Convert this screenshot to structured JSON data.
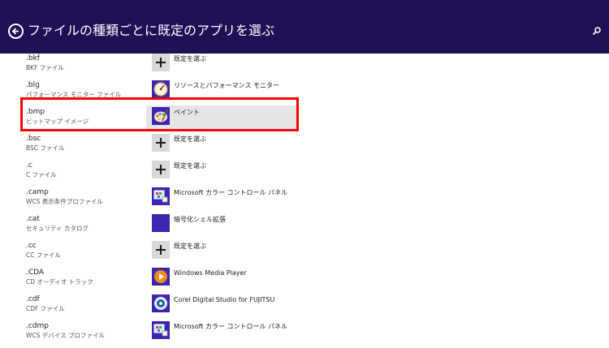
{
  "header": {
    "title": "ファイルの種類ごとに既定のアプリを選ぶ",
    "background_color": "#1f0f55",
    "back_icon": "back-arrow-circle-icon",
    "search_icon": "search-icon"
  },
  "highlight_color": "#ff0000",
  "associations": [
    {
      "ext": ".bkf",
      "desc": "BKF ファイル",
      "app": "既定を選ぶ",
      "icon": "plus-icon"
    },
    {
      "ext": ".blg",
      "desc": "パフォーマンス モニター ファイル",
      "app": "リソースとパフォーマンス モニター",
      "icon": "performance-monitor-icon"
    },
    {
      "ext": ".bmp",
      "desc": "ビットマップ イメージ",
      "app": "ペイント",
      "icon": "paint-icon",
      "selected": true
    },
    {
      "ext": ".bsc",
      "desc": "BSC ファイル",
      "app": "既定を選ぶ",
      "icon": "plus-icon"
    },
    {
      "ext": ".c",
      "desc": "C ファイル",
      "app": "既定を選ぶ",
      "icon": "plus-icon"
    },
    {
      "ext": ".camp",
      "desc": "WCS 表示条件プロファイル",
      "app": "Microsoft カラー コントロール パネル",
      "icon": "color-control-panel-icon"
    },
    {
      "ext": ".cat",
      "desc": "セキュリティ カタログ",
      "app": "暗号化シェル拡張",
      "icon": "crypto-shell-icon"
    },
    {
      "ext": ".cc",
      "desc": "CC ファイル",
      "app": "既定を選ぶ",
      "icon": "plus-icon"
    },
    {
      "ext": ".CDA",
      "desc": "CD オーディオ トラック",
      "app": "Windows Media Player",
      "icon": "media-player-icon"
    },
    {
      "ext": ".cdf",
      "desc": "CDF ファイル",
      "app": "Corel Digital Studio for FUJITSU",
      "icon": "corel-studio-icon"
    },
    {
      "ext": ".cdmp",
      "desc": "WCS デバイス プロファイル",
      "app": "Microsoft カラー コントロール パネル",
      "icon": "color-control-panel-icon"
    }
  ]
}
